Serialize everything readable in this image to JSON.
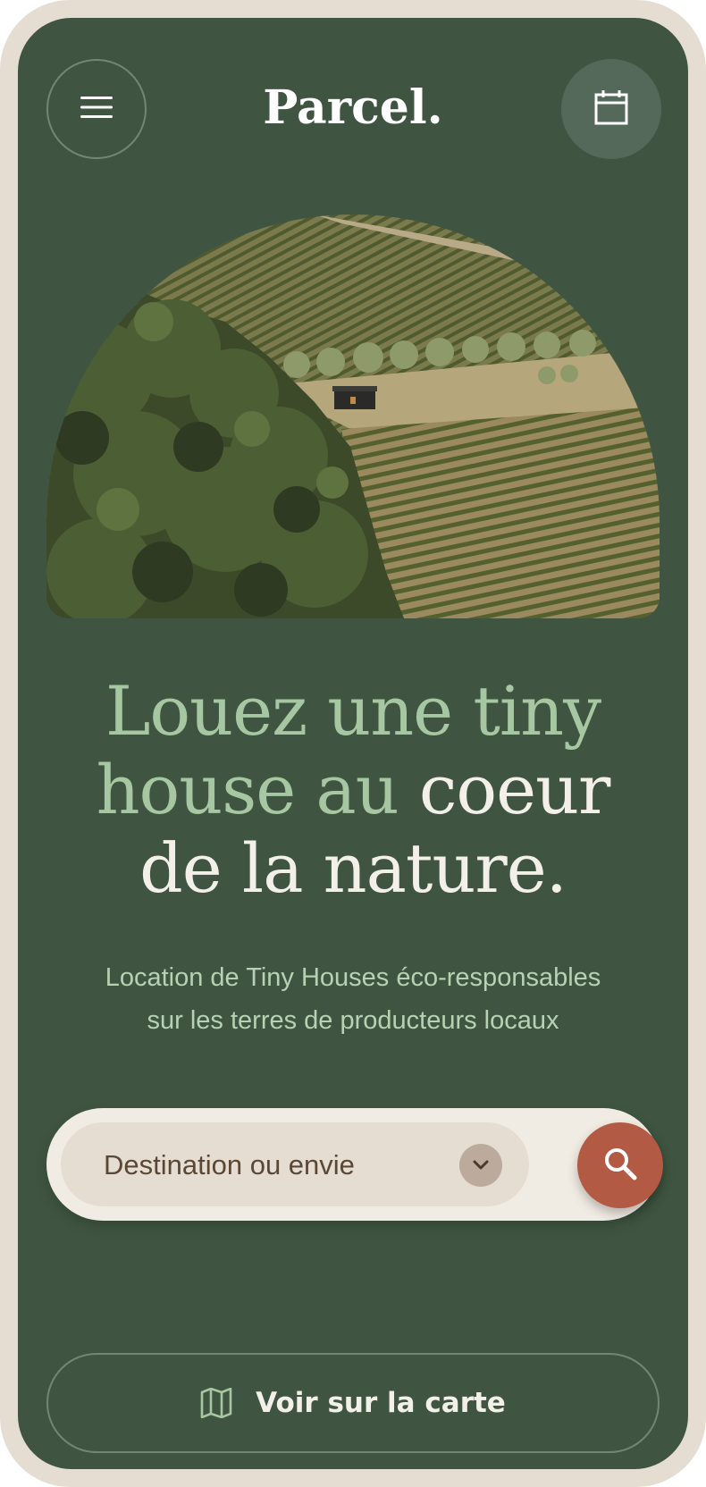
{
  "header": {
    "logo": "Parcel.",
    "menu_icon": "menu-icon",
    "calendar_icon": "calendar-icon"
  },
  "hero": {
    "image_alt": "aerial-vineyard-tiny-house-photo",
    "headline": {
      "line1": "Louez une tiny",
      "line2_green": "house au ",
      "line2_white": "coeur",
      "line3": "de la nature."
    },
    "subtitle": {
      "line1": "Location de Tiny Houses éco-responsables",
      "line2": "sur les terres de producteurs locaux"
    }
  },
  "search": {
    "destination_label": "Destination ou envie",
    "chevron_icon": "chevron-down-icon",
    "search_icon": "search-icon"
  },
  "map_button": {
    "label": "Voir sur la carte",
    "icon": "map-icon"
  },
  "colors": {
    "background": "#3f5541",
    "frame": "#e6ddd2",
    "headline_green": "#a6c7a1",
    "headline_white": "#f3f0e9",
    "search_button": "#b25a43"
  }
}
